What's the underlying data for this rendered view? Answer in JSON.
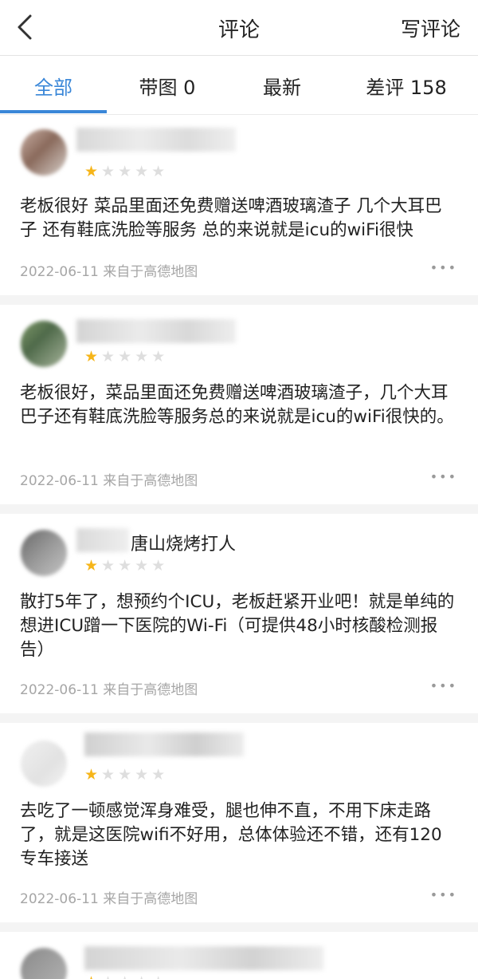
{
  "header": {
    "title": "评论",
    "write_label": "写评论"
  },
  "tabs": [
    {
      "label": "全部"
    },
    {
      "label": "带图 0"
    },
    {
      "label": "最新"
    },
    {
      "label": "差评 158"
    }
  ],
  "reviews": [
    {
      "rating": 1,
      "text": "老板很好 菜品里面还免费赠送啤酒玻璃渣子 几个大耳巴子 还有鞋底洗脸等服务 总的来说就是icu的wiFi很快",
      "date": "2022-06-11",
      "source": "来自于高德地图"
    },
    {
      "rating": 1,
      "text": "老板很好，菜品里面还免费赠送啤酒玻璃渣子，几个大耳巴子还有鞋底洗脸等服务总的来说就是icu的wiFi很快的。",
      "date": "2022-06-11",
      "source": "来自于高德地图"
    },
    {
      "nickname": "唐山烧烤打人",
      "rating": 1,
      "text": "散打5年了，想预约个ICU，老板赶紧开业吧！就是单纯的想进ICU蹭一下医院的Wi-Fi（可提供48小时核酸检测报告）",
      "date": "2022-06-11",
      "source": "来自于高德地图"
    },
    {
      "rating": 1,
      "text": "去吃了一顿感觉浑身难受，腿也伸不直，不用下床走路了，就是这医院wifi不好用，总体体验还不错，还有120专车接送",
      "date": "2022-06-11",
      "source": "来自于高德地图"
    }
  ],
  "more_icon": "more-dots-icon",
  "colors": {
    "accent": "#3a87d8",
    "star_on": "#f6b519",
    "star_off": "#dedede",
    "meta": "#a6a6a6"
  }
}
